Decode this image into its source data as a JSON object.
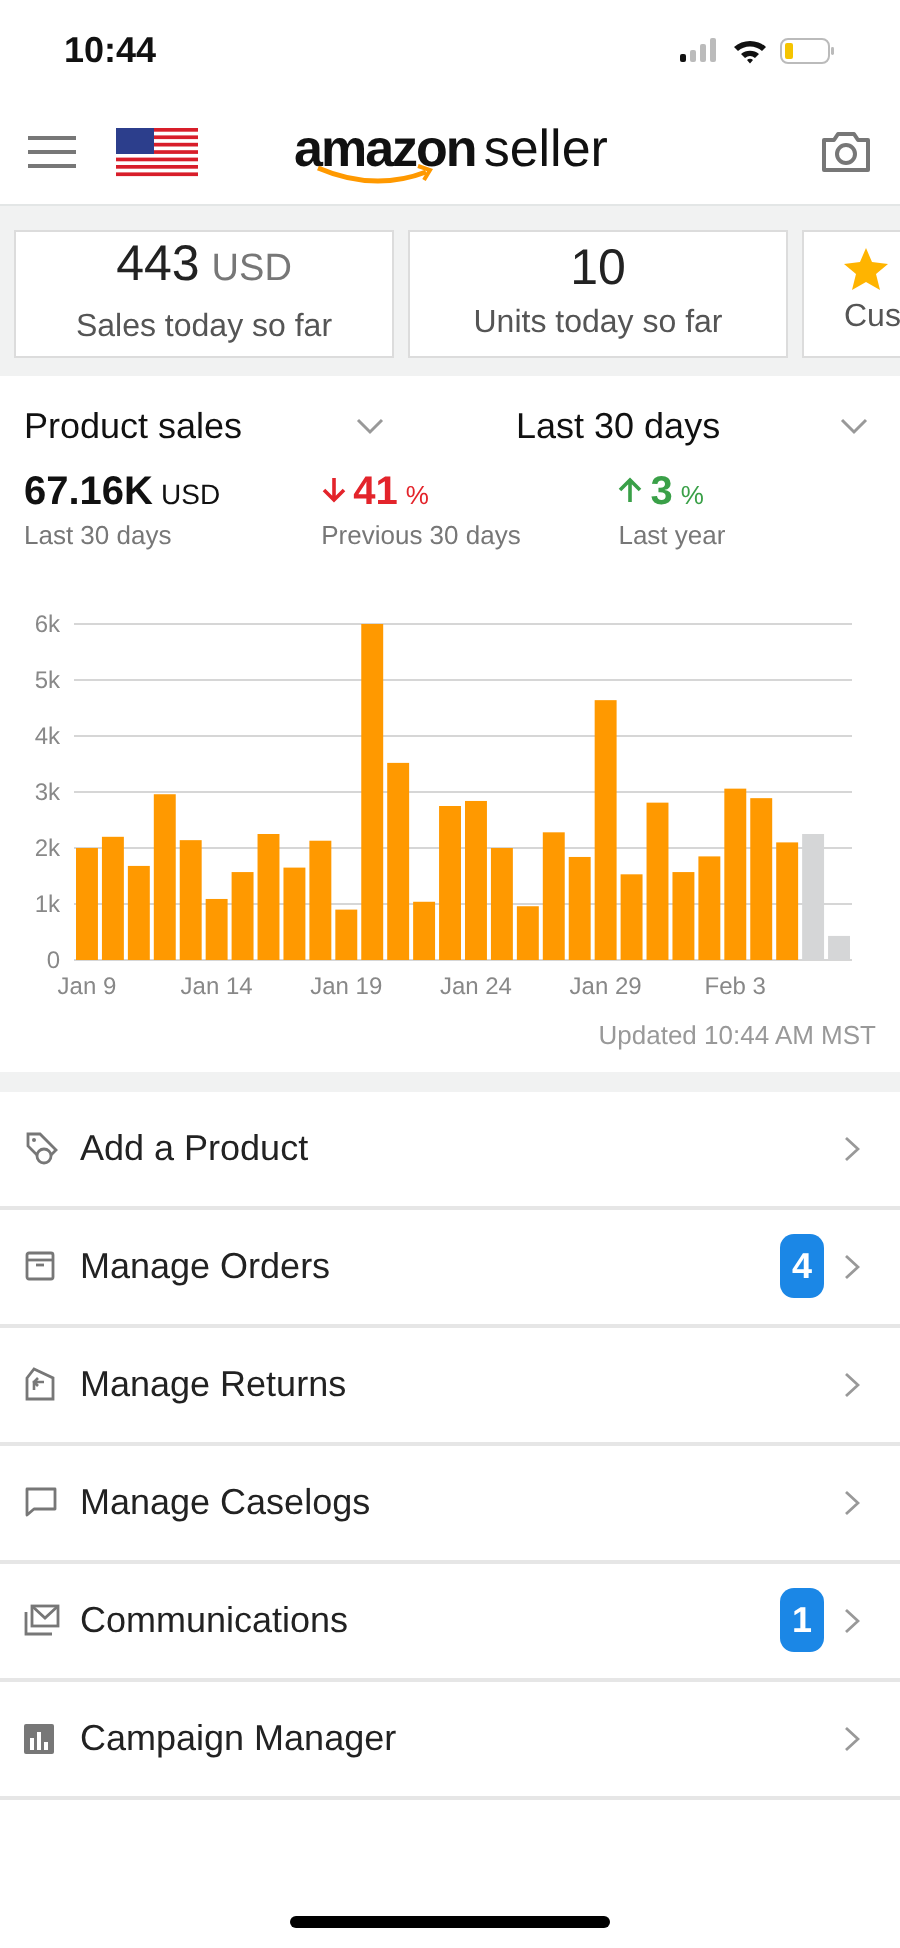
{
  "status_bar": {
    "time": "10:44"
  },
  "header": {
    "logo": {
      "brand": "amazon",
      "suffix": "seller"
    }
  },
  "summary_cards": [
    {
      "value": "443",
      "unit": "USD",
      "label": "Sales today so far",
      "kind": "value"
    },
    {
      "value": "10",
      "label": "Units today so far",
      "kind": "value"
    },
    {
      "label": "Cus",
      "kind": "rating"
    }
  ],
  "sales": {
    "metric_selector": "Product sales",
    "period_selector": "Last 30 days",
    "stats": [
      {
        "value": "67.16K",
        "unit": "USD",
        "label": "Last 30 days",
        "kind": "total"
      },
      {
        "value": "41",
        "unit": "%",
        "label": "Previous 30 days",
        "kind": "down"
      },
      {
        "value": "3",
        "unit": "%",
        "label": "Last year",
        "kind": "up"
      }
    ],
    "chart_data": {
      "type": "bar",
      "grid": true,
      "categories": [
        "Jan 9",
        null,
        null,
        null,
        null,
        "Jan 14",
        null,
        null,
        null,
        null,
        "Jan 19",
        null,
        null,
        null,
        null,
        "Jan 24",
        null,
        null,
        null,
        null,
        "Jan 29",
        null,
        null,
        null,
        null,
        "Feb 3",
        null,
        null,
        null,
        null
      ],
      "yticks": [
        {
          "value": 0,
          "label": "0"
        },
        {
          "value": 1000,
          "label": "1k"
        },
        {
          "value": 2000,
          "label": "2k"
        },
        {
          "value": 3000,
          "label": "3k"
        },
        {
          "value": 4000,
          "label": "4k"
        },
        {
          "value": 5000,
          "label": "5k"
        },
        {
          "value": 6000,
          "label": "6k"
        }
      ],
      "ylim": [
        0,
        6000
      ],
      "series": [
        {
          "color": "#ff9900",
          "values": [
            2000,
            2200,
            1680,
            2960,
            2140,
            1090,
            1570,
            2250,
            1650,
            2130,
            900,
            6000,
            3520,
            1040,
            2750,
            2840,
            2000,
            960,
            2280,
            1840,
            4640,
            1530,
            2810,
            1570,
            1850,
            3060,
            2890,
            2100,
            null,
            null
          ]
        },
        {
          "color": "#d5d6d7",
          "values": [
            null,
            null,
            null,
            null,
            null,
            null,
            null,
            null,
            null,
            null,
            null,
            null,
            null,
            null,
            null,
            null,
            null,
            null,
            null,
            null,
            null,
            null,
            null,
            null,
            null,
            null,
            null,
            null,
            2250,
            430
          ]
        }
      ]
    },
    "updated": "Updated 10:44 AM MST"
  },
  "menu": [
    {
      "label": "Add a Product"
    },
    {
      "label": "Manage Orders",
      "badge": "4"
    },
    {
      "label": "Manage Returns"
    },
    {
      "label": "Manage Caselogs"
    },
    {
      "label": "Communications",
      "badge": "1"
    },
    {
      "label": "Campaign Manager"
    }
  ]
}
